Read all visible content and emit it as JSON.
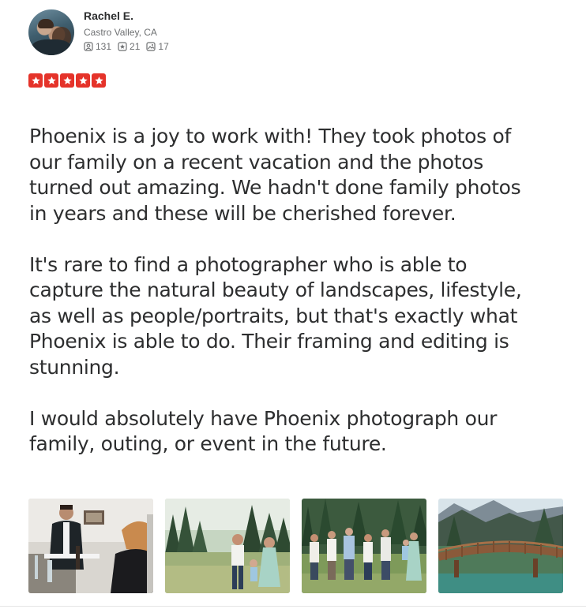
{
  "user": {
    "name": "Rachel E.",
    "location": "Castro Valley, CA",
    "friends": "131",
    "reviews": "21",
    "photos": "17",
    "avatar_icon": "user-avatar"
  },
  "rating": {
    "stars": 5,
    "max": 5,
    "color": "#e5332a"
  },
  "review": {
    "paragraphs": [
      "Phoenix is a joy to work with! They took photos of our family on a recent vacation and the photos turned out amazing. We hadn't done family photos in years and these will be cherished forever.",
      "It's rare to find a photographer who is able to capture the natural beauty of landscapes, lifestyle, as well as people/portraits, but that's exactly what Phoenix is able to do. Their framing and editing is stunning.",
      "I would absolutely have Phoenix photograph our family, outing, or event in the future."
    ]
  },
  "photos": [
    {
      "subject": "restaurant-waiter"
    },
    {
      "subject": "family-forest-walk"
    },
    {
      "subject": "family-group-portrait"
    },
    {
      "subject": "wooden-bridge-lake"
    }
  ]
}
